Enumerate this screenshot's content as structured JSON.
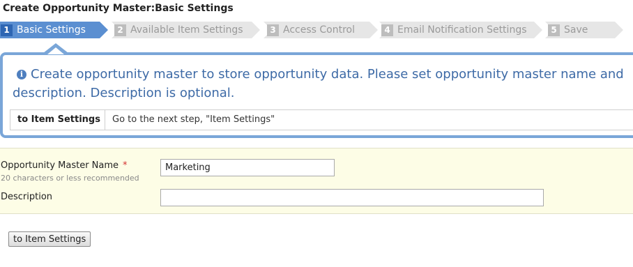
{
  "page": {
    "title": "Create Opportunity Master:Basic Settings"
  },
  "wizard": {
    "steps": [
      {
        "number": "1",
        "label": "Basic Settings",
        "state": "active"
      },
      {
        "number": "2",
        "label": "Available Item Settings",
        "state": "inactive"
      },
      {
        "number": "3",
        "label": "Access Control",
        "state": "inactive"
      },
      {
        "number": "4",
        "label": "Email Notification Settings",
        "state": "inactive"
      },
      {
        "number": "5",
        "label": "Save",
        "state": "inactive"
      }
    ],
    "colors": {
      "active_bg": "#5b8fd1",
      "inactive_bg": "#e6e6e6"
    }
  },
  "info": {
    "icon": "info-circle-icon",
    "message": "Create opportunity master to store opportunity data. Please set opportunity master name and description. Description is optional.",
    "table": {
      "key": "to Item Settings",
      "value": "Go to the next step, \"Item Settings\""
    }
  },
  "form": {
    "name_field": {
      "label": "Opportunity Master Name",
      "required_mark": "*",
      "hint": "20 characters or less recommended",
      "value": "Marketing"
    },
    "description_field": {
      "label": "Description",
      "value": ""
    }
  },
  "actions": {
    "next_label": "to Item Settings"
  }
}
